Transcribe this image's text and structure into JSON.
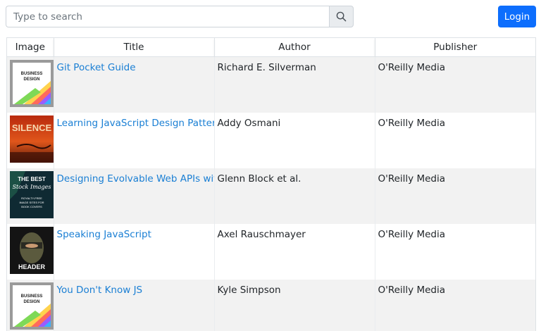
{
  "search": {
    "placeholder": "Type to search",
    "value": ""
  },
  "header": {
    "login_label": "Login"
  },
  "table": {
    "columns": [
      "Image",
      "Title",
      "Author",
      "Publisher"
    ],
    "rows": [
      {
        "cover": "business-design-cover",
        "title": "Git Pocket Guide",
        "author": "Richard E. Silverman",
        "publisher": "O'Reilly Media"
      },
      {
        "cover": "silence-cover",
        "title": "Learning JavaScript Design Patterns",
        "author": "Addy Osmani",
        "publisher": "O'Reilly Media"
      },
      {
        "cover": "stock-images-cover",
        "title": "Designing Evolvable Web APIs with ASP.NET",
        "author": "Glenn Block et al.",
        "publisher": "O'Reilly Media"
      },
      {
        "cover": "header-cover",
        "title": "Speaking JavaScript",
        "author": "Axel Rauschmayer",
        "publisher": "O'Reilly Media"
      },
      {
        "cover": "business-design-cover",
        "title": "You Don't Know JS",
        "author": "Kyle Simpson",
        "publisher": "O'Reilly Media"
      }
    ]
  },
  "covers": {
    "business_design": {
      "line1": "BUSINESS",
      "line2": "DESIGN"
    },
    "silence": {
      "text": "SILENCE"
    },
    "stock": {
      "line1": "THE BEST",
      "line2": "Stock Images",
      "line3": "ROYALTY-FREE",
      "line4": "IMAGE SITES FOR",
      "line5": "BOOK COVERS"
    },
    "header_cover": {
      "text": "HEADER"
    }
  },
  "colors": {
    "primary": "#0d6efd",
    "link": "#1a7fd4",
    "stripe": "#f2f2f2"
  }
}
